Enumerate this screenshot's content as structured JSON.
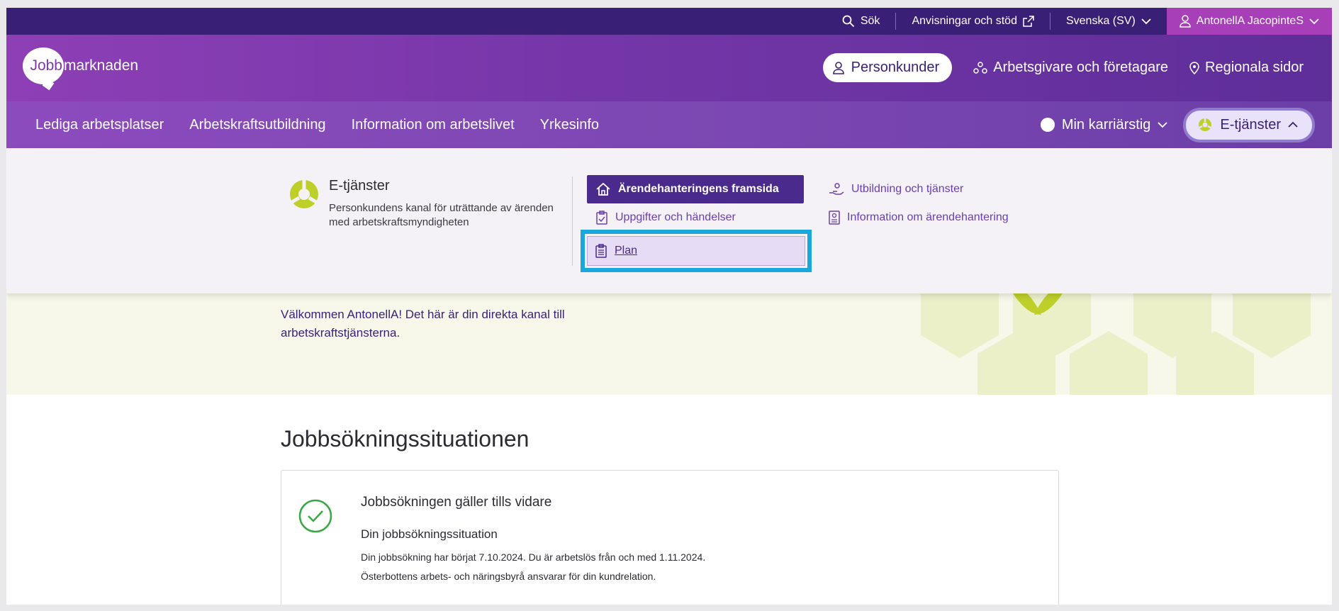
{
  "utility_bar": {
    "search_label": "Sök",
    "guidance_label": "Anvisningar och stöd",
    "language_label": "Svenska (SV)",
    "user_label": "AntonellA JacopinteS"
  },
  "header": {
    "logo_part1": "Jobb",
    "logo_part2": "marknaden",
    "personkunder": "Personkunder",
    "arbetsgivare": "Arbetsgivare och företagare",
    "regionala": "Regionala sidor"
  },
  "main_nav": {
    "items": [
      "Lediga arbetsplatser",
      "Arbetskraftsutbildning",
      "Information om arbetslivet",
      "Yrkesinfo"
    ],
    "karriarstig": "Min karriärstig",
    "etjanster": "E-tjänster"
  },
  "dropdown": {
    "title": "E-tjänster",
    "description": "Personkundens kanal för uträttande av ärenden med arbetskraftsmyndigheten",
    "links": {
      "framsida": "Ärendehanteringens framsida",
      "uppgifter": "Uppgifter och händelser",
      "plan": "Plan",
      "utbildning": "Utbildning och tjänster",
      "information": "Information om ärendehantering"
    }
  },
  "hero": {
    "welcome": "Välkommen AntonellA! Det här är din direkta kanal till arbetskraftstjänsterna."
  },
  "content": {
    "heading": "Jobbsökningssituationen",
    "card": {
      "title": "Jobbsökningen gäller tills vidare",
      "subtitle": "Din jobbsökningssituation",
      "line1": "Din jobbsökning har börjat 7.10.2024. Du är arbetslös från och med 1.11.2024.",
      "line2": "Österbottens arbets- och näringsbyrå ansvarar för din kundrelation."
    }
  },
  "colors": {
    "utility_bg": "#3a1f77",
    "user_bg": "#a73fb8",
    "accent_purple": "#4a2a8c",
    "highlight_blue": "#1aa7dc",
    "success_green": "#3aa845",
    "logo_lime": "#bfcf2a"
  }
}
